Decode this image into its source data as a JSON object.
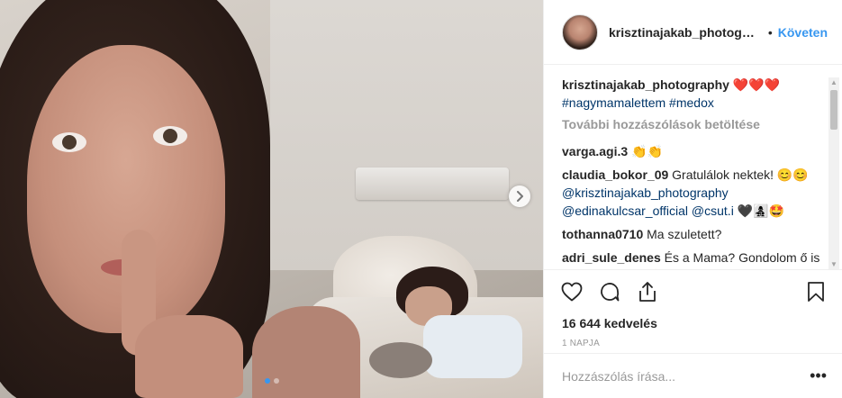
{
  "post": {
    "username": "krisztinajakab_photogra...",
    "follow_label": "Követen",
    "separator": "•"
  },
  "caption": {
    "username": "krisztinajakab_photography",
    "text": "❤️❤️❤️",
    "hashtags": "#nagymamalettem #medox"
  },
  "load_more": "További hozzászólások betöltése",
  "comments": [
    {
      "user": "varga.agi.3",
      "text": "👏👏"
    },
    {
      "user": "claudia_bokor_09",
      "text": "Gratulálok nektek! 😊😊",
      "mentions": "@krisztinajakab_photography @edinakulcsar_official @csut.i",
      "suffix": "🖤👩‍👧‍👦🤩"
    },
    {
      "user": "tothanna0710",
      "text": "Ma szuletett?"
    },
    {
      "user": "adri_sule_denes",
      "text": "És a Mama? Gondolom ő is nagyon boldog 😘"
    }
  ],
  "likes": "16 644 kedvelés",
  "time": "1 NAPJA",
  "comment_box": {
    "placeholder": "Hozzászólás írása...",
    "more": "•••"
  },
  "carousel": {
    "slides": 2,
    "active": 0
  },
  "icons": {
    "like": "heart-icon",
    "comment": "comment-icon",
    "share": "share-icon",
    "save": "bookmark-icon",
    "next": "chevron-right-icon"
  },
  "colors": {
    "link": "#3897f0",
    "text": "#262626",
    "muted": "#999999",
    "tag": "#003569"
  }
}
